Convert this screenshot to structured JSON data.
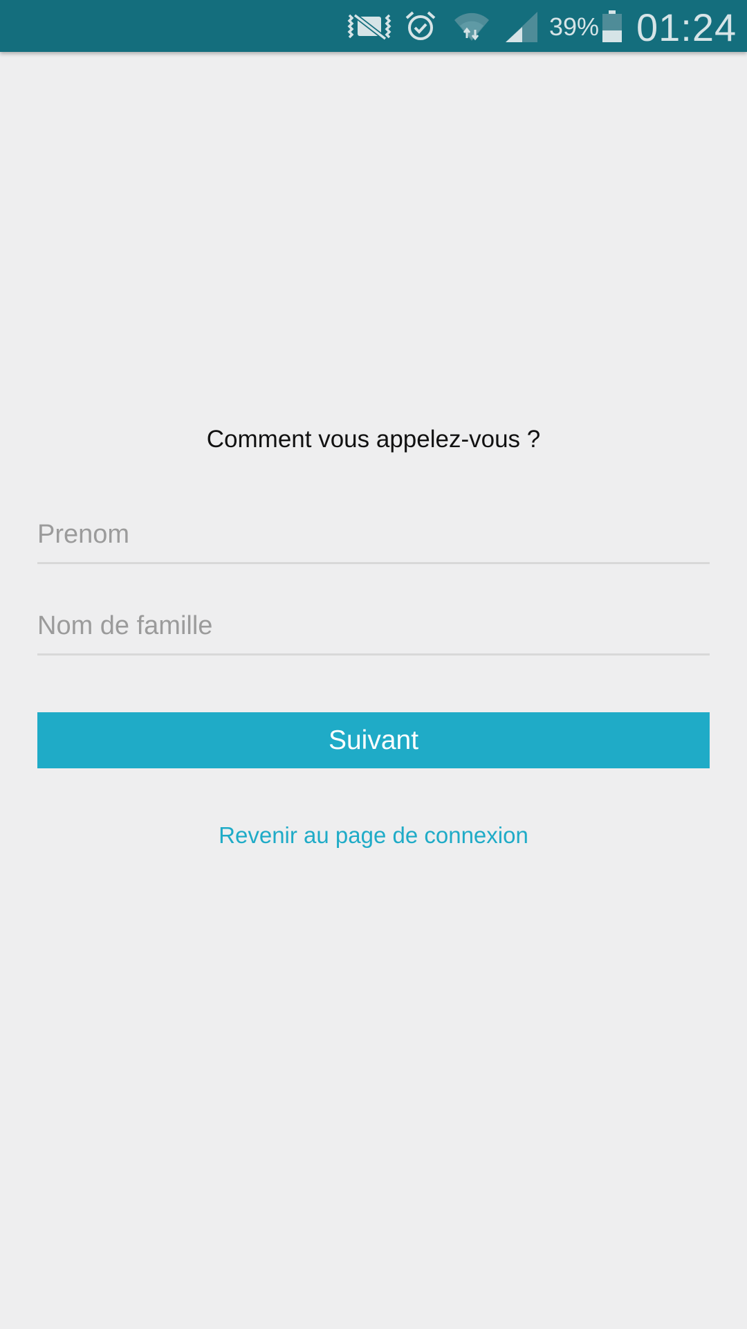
{
  "status_bar": {
    "battery_percent": "39%",
    "clock": "01:24",
    "icons": [
      "vibrate-muted-icon",
      "alarm-icon",
      "wifi-icon",
      "signal-icon",
      "battery-icon"
    ],
    "battery_level": 0.39,
    "colors": {
      "background": "#146e7d",
      "foreground": "#d6e4e7"
    }
  },
  "form": {
    "question": "Comment vous appelez-vous ?",
    "first_name": {
      "value": "",
      "placeholder": "Prenom"
    },
    "last_name": {
      "value": "",
      "placeholder": "Nom de famille"
    },
    "next_label": "Suivant",
    "back_link_label": "Revenir au page de connexion"
  },
  "colors": {
    "background": "#eeeeef",
    "accent": "#1fabc7",
    "placeholder": "#9b9b9b",
    "divider": "#d8d8d8"
  }
}
